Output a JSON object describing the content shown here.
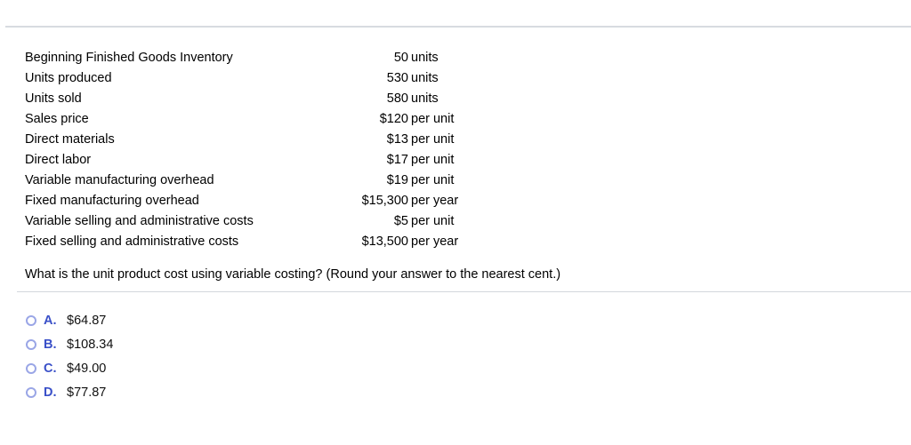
{
  "rows": [
    {
      "label": "Beginning Finished Goods Inventory",
      "value": "50",
      "unit": "units"
    },
    {
      "label": "Units produced",
      "value": "530",
      "unit": "units"
    },
    {
      "label": "Units sold",
      "value": "580",
      "unit": "units"
    },
    {
      "label": "Sales price",
      "value": "$120",
      "unit": "per unit"
    },
    {
      "label": "Direct materials",
      "value": "$13",
      "unit": "per unit"
    },
    {
      "label": "Direct labor",
      "value": "$17",
      "unit": "per unit"
    },
    {
      "label": "Variable manufacturing overhead",
      "value": "$19",
      "unit": "per unit"
    },
    {
      "label": "Fixed manufacturing overhead",
      "value": "$15,300",
      "unit": "per year"
    },
    {
      "label": "Variable selling and administrative costs",
      "value": "$5",
      "unit": "per unit"
    },
    {
      "label": "Fixed selling and administrative costs",
      "value": "$13,500",
      "unit": "per year"
    }
  ],
  "question": "What is the unit product cost using variable costing? (Round your answer to the nearest cent.)",
  "options": [
    {
      "letter": "A.",
      "text": "$64.87",
      "selected": false
    },
    {
      "letter": "B.",
      "text": "$108.34",
      "selected": false
    },
    {
      "letter": "C.",
      "text": "$49.00",
      "selected": false
    },
    {
      "letter": "D.",
      "text": "$77.87",
      "selected": false
    }
  ],
  "colors": {
    "option_letter": "#3a50c8",
    "radio_border": "#9aa6e6",
    "divider": "#d7dbe0"
  }
}
